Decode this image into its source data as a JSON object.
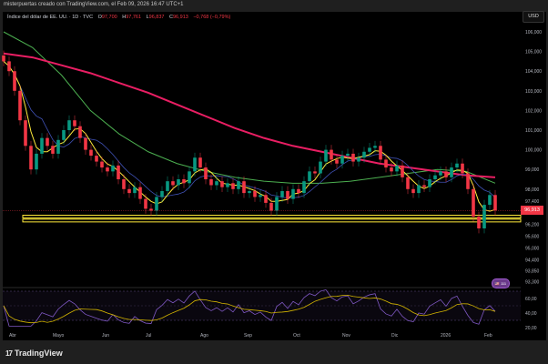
{
  "header": {
    "credit": "misterpuertas creado con TradingView.com, el Feb 09, 2026 16:47 UTC+1"
  },
  "legend": {
    "symbol": "Índice del dólar de EE. UU. · 1D · TVC",
    "o_label": "O",
    "o": "97,700",
    "h_label": "H",
    "h": "97,761",
    "l_label": "L",
    "l": "96,837",
    "c_label": "C",
    "c": "96,913",
    "change": "−0,768 (−0,79%)"
  },
  "axis": {
    "currency": "USD",
    "last_price": "96,913",
    "flag_badge": "🇺🇸 111"
  },
  "footer": {
    "brand": "TradingView",
    "logo_mark": "17"
  },
  "colors": {
    "up": "#089981",
    "down": "#f23645",
    "ma200": "#e91e63",
    "ma100": "#4caf50",
    "ma20": "#ffeb3b",
    "ma50": "#3f51b5",
    "support": "#ffeb3b",
    "rsi": "#7e57c2",
    "rsi_ma": "#d4b500"
  },
  "chart_data": {
    "type": "candlestick",
    "price_ticks": [
      "106,000",
      "105,000",
      "104,000",
      "103,000",
      "102,000",
      "101,000",
      "100,000",
      "99,000",
      "98,000",
      "97,400",
      "96,200",
      "95,600",
      "95,000",
      "94,400",
      "93,850",
      "93,300"
    ],
    "price_tick_values": [
      106,
      105,
      104,
      103,
      102,
      101,
      100,
      99,
      98,
      97.4,
      96.2,
      95.6,
      95,
      94.4,
      93.85,
      93.3
    ],
    "rsi_ticks": [
      "60,00",
      "40,00",
      "20,00"
    ],
    "rsi_tick_values": [
      60,
      40,
      20
    ],
    "x_labels": [
      "Abr",
      "Mayo",
      "Jun",
      "Jul",
      "Ago",
      "Sep",
      "Oct",
      "Nov",
      "Dic",
      "2026",
      "Feb"
    ],
    "x_label_index": [
      1,
      9,
      18,
      26,
      36,
      44,
      53,
      62,
      71,
      80,
      88
    ],
    "closes": [
      104.5,
      104,
      103,
      101.5,
      100.2,
      99,
      99.8,
      100.6,
      100.2,
      99.8,
      100.5,
      101,
      101.5,
      101.2,
      100.6,
      100,
      99.7,
      99.4,
      99.1,
      98.9,
      99.2,
      98.5,
      98,
      97.8,
      98.1,
      97.5,
      97,
      96.9,
      97.6,
      97.9,
      98.4,
      98.2,
      98.5,
      98.3,
      98.9,
      99.6,
      99.1,
      98.5,
      98.2,
      98.4,
      98.1,
      98.3,
      98,
      98.4,
      97.8,
      97.9,
      97.6,
      97.7,
      97.3,
      96.9,
      97.6,
      97.9,
      97.5,
      98,
      97.8,
      98.4,
      98.9,
      98.8,
      99.4,
      100,
      99.5,
      99.3,
      99.7,
      99.8,
      99.4,
      99.6,
      99.9,
      100.1,
      100.2,
      99.5,
      99.1,
      98.9,
      99.2,
      98.6,
      98,
      97.8,
      98.2,
      98.1,
      98.5,
      98.7,
      98.9,
      98.6,
      99.1,
      99.3,
      98.8,
      98,
      96.6,
      96,
      97.2,
      97.7,
      96.913
    ],
    "ma200": [
      104.9,
      104.7,
      104.3,
      103.9,
      103.4,
      102.9,
      102.3,
      101.7,
      101.1,
      100.6,
      100.2,
      99.9,
      99.6,
      99.3,
      99.1,
      98.9,
      98.7,
      98.6
    ],
    "ma100": [
      106,
      105.2,
      103.8,
      102,
      100.8,
      99.9,
      99.3,
      98.9,
      98.6,
      98.4,
      98.3,
      98.3,
      98.4,
      98.6,
      98.8,
      99,
      98.9,
      98.3
    ],
    "support_levels": [
      96.6,
      96.4
    ],
    "rsi_bands": [
      70,
      30
    ]
  }
}
